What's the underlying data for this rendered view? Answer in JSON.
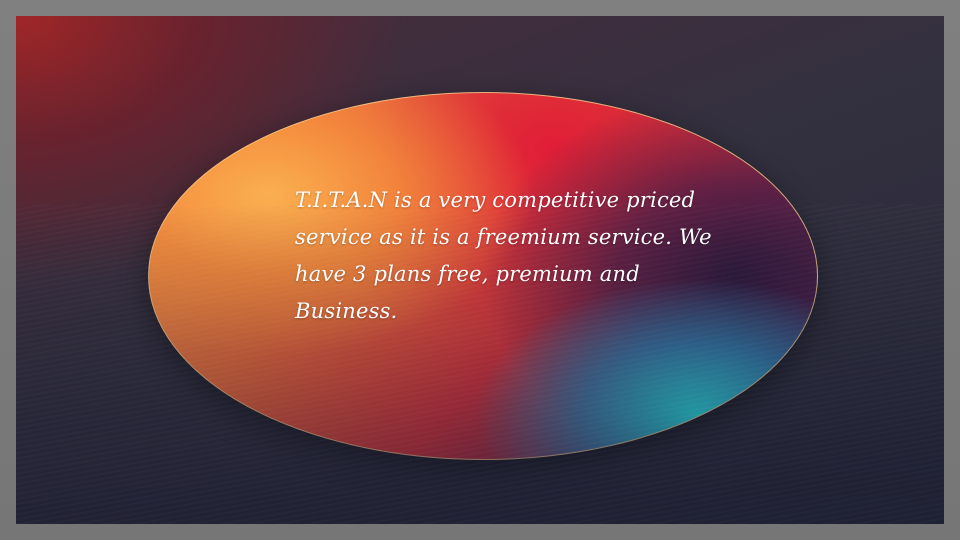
{
  "slide": {
    "body_text": "T.I.T.A.N is a very competitive priced service as it is a freemium service. We have 3 plans free, premium and Business."
  },
  "colors": {
    "frame": "#7a7a7a",
    "background_dark": "#282a3a",
    "background_red": "#a52626",
    "oval_orange": "#f4a24a",
    "oval_red": "#d8323c",
    "oval_cyan": "#28dce1",
    "text": "#ffffff"
  }
}
